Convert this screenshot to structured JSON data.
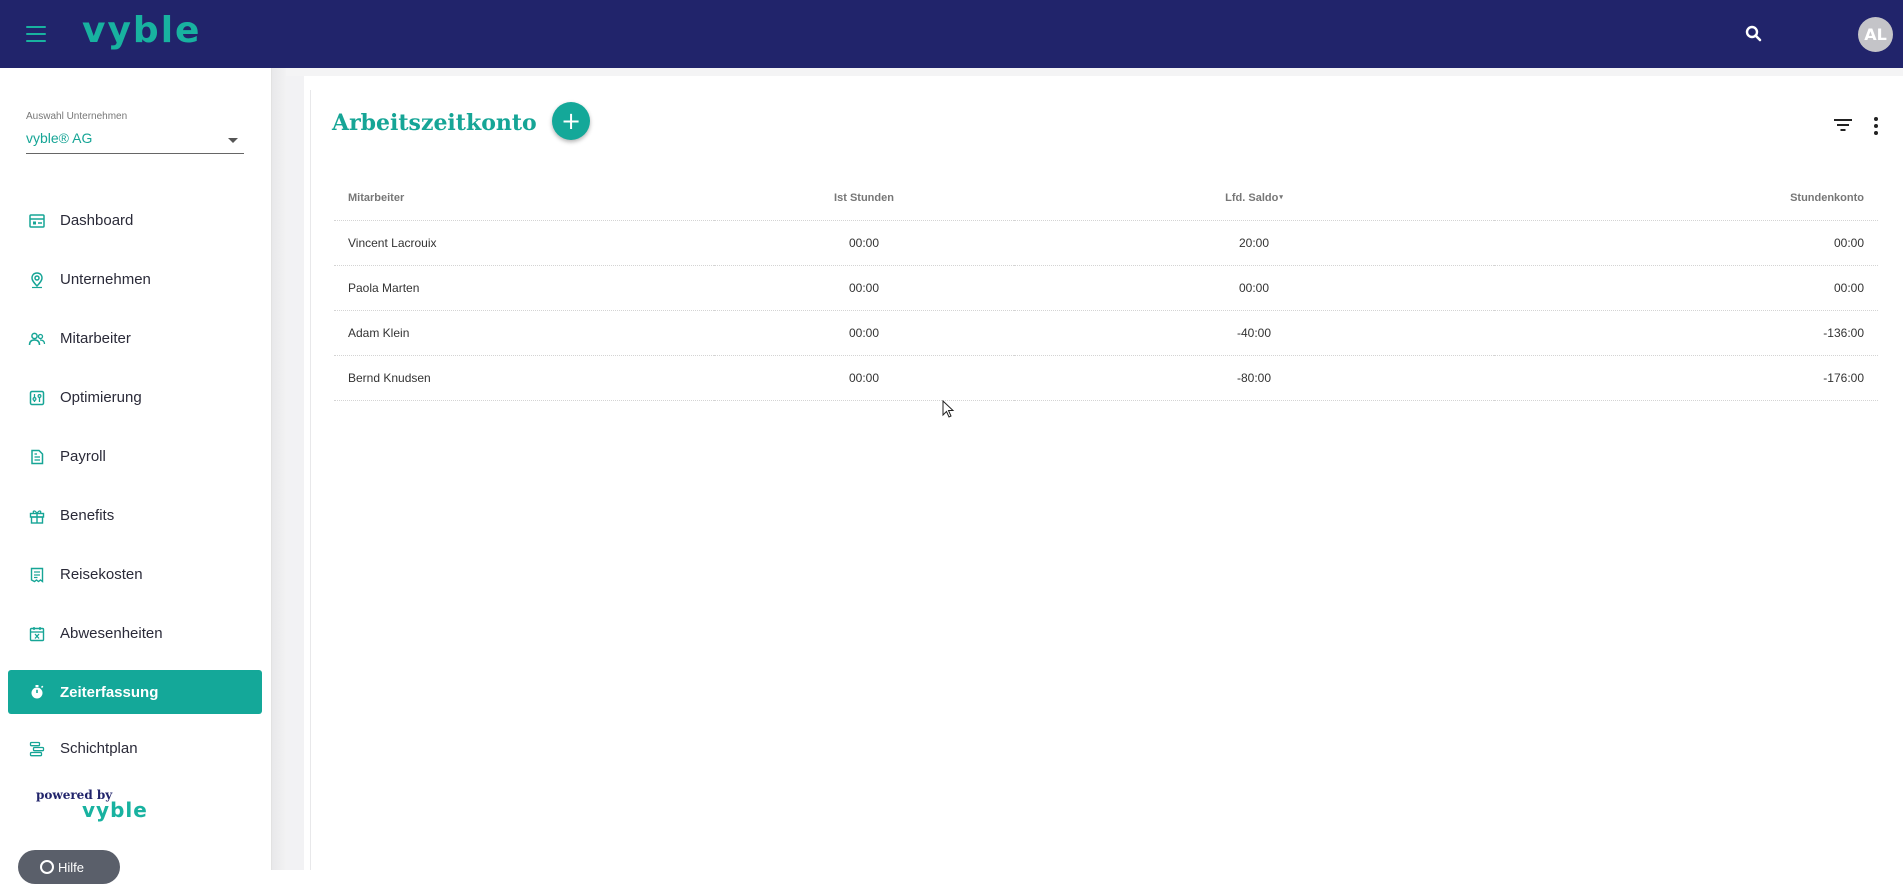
{
  "header": {
    "brand": "vyble",
    "avatar_initials": "AL",
    "colors": {
      "bar": "#21246b",
      "accent": "#18b2a0"
    },
    "icons": [
      "menu-icon",
      "search-icon"
    ]
  },
  "sidebar": {
    "company_label": "Auswahl Unternehmen",
    "company_value": "vyble® AG",
    "items": [
      {
        "label": "Dashboard",
        "icon": "dashboard-icon",
        "active": false
      },
      {
        "label": "Unternehmen",
        "icon": "location-pin-icon",
        "active": false
      },
      {
        "label": "Mitarbeiter",
        "icon": "people-icon",
        "active": false
      },
      {
        "label": "Optimierung",
        "icon": "optimization-icon",
        "active": false
      },
      {
        "label": "Payroll",
        "icon": "payroll-icon",
        "active": false
      },
      {
        "label": "Benefits",
        "icon": "gift-icon",
        "active": false
      },
      {
        "label": "Reisekosten",
        "icon": "receipt-icon",
        "active": false
      },
      {
        "label": "Abwesenheiten",
        "icon": "calendar-x-icon",
        "active": false
      },
      {
        "label": "Zeiterfassung",
        "icon": "stopwatch-icon",
        "active": true
      },
      {
        "label": "Schichtplan",
        "icon": "shift-plan-icon",
        "active": false
      }
    ],
    "powered_by": "powered by",
    "powered_logo": "vyble",
    "help_label": "Hilfe"
  },
  "main": {
    "title": "Arbeitszeitkonto",
    "add_label": "+",
    "table": {
      "headers": [
        "Mitarbeiter",
        "Ist Stunden",
        "Lfd. Saldo",
        "Stundenkonto"
      ],
      "sort_indicator": "▾",
      "rows": [
        [
          "Vincent Lacrouix",
          "00:00",
          "20:00",
          "00:00"
        ],
        [
          "Paola Marten",
          "00:00",
          "00:00",
          "00:00"
        ],
        [
          "Adam Klein",
          "00:00",
          "-40:00",
          "-136:00"
        ],
        [
          "Bernd Knudsen",
          "00:00",
          "-80:00",
          "-176:00"
        ]
      ]
    }
  }
}
